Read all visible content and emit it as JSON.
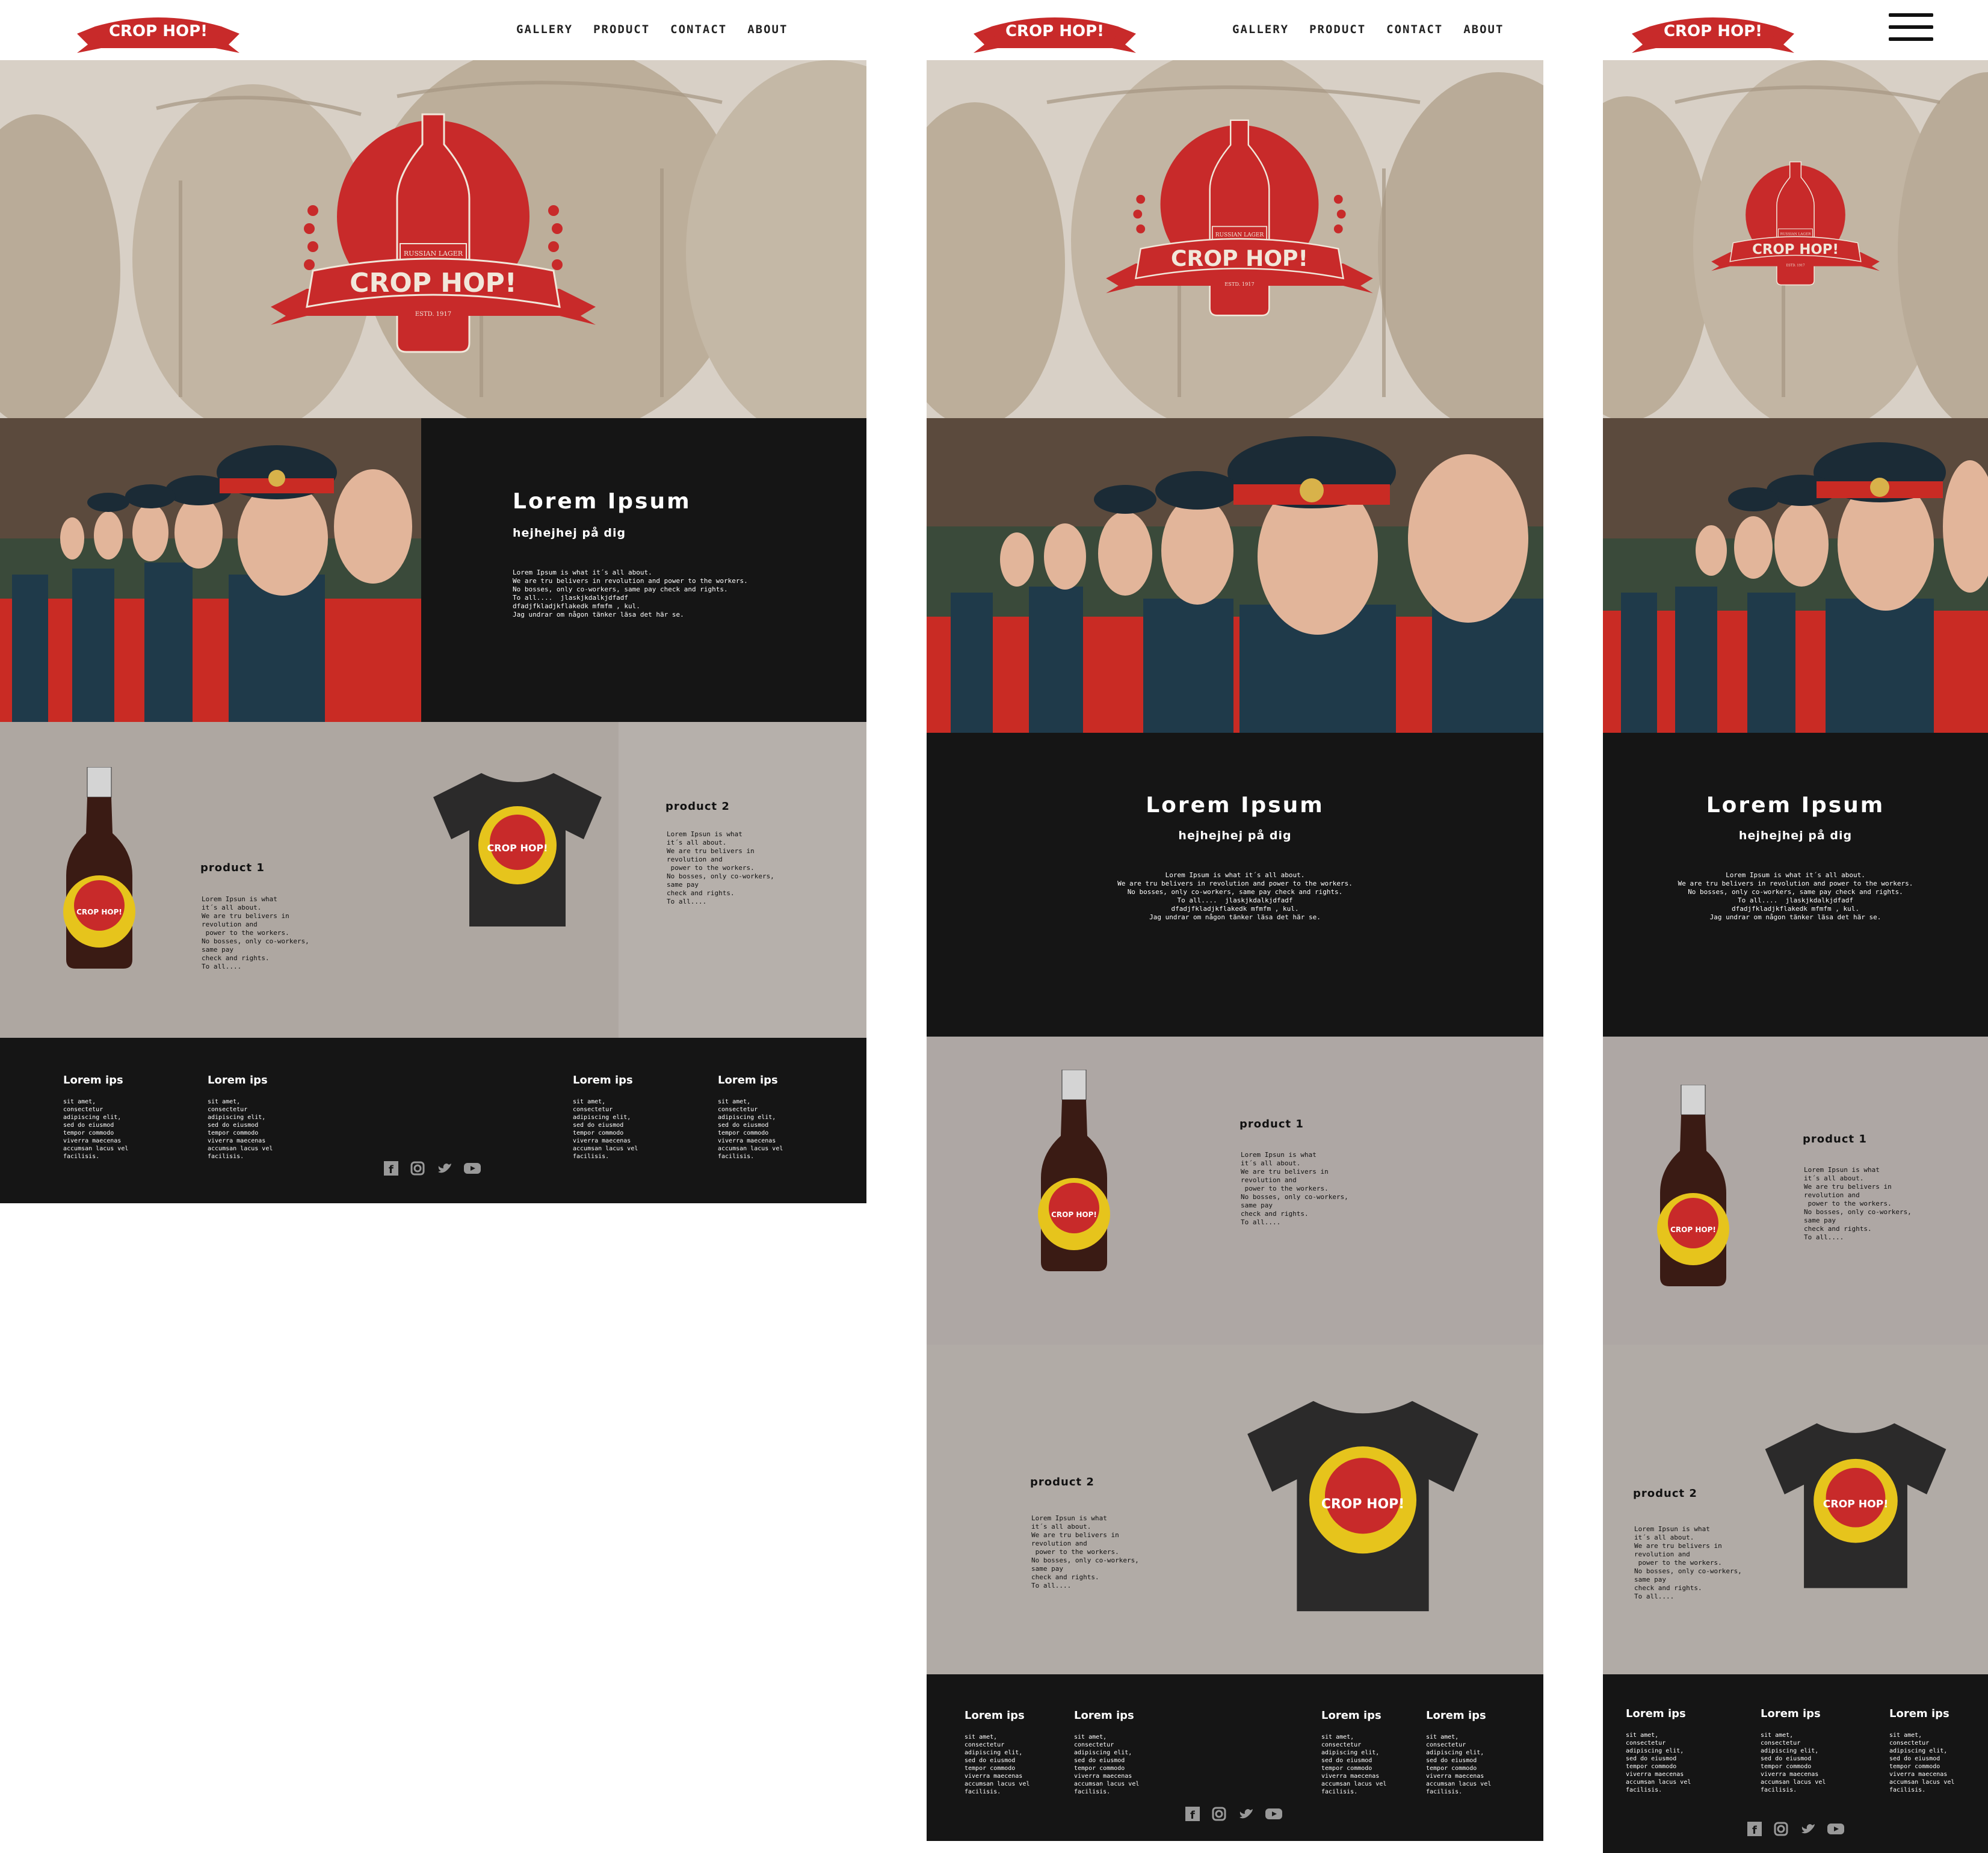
{
  "brand": {
    "name": "CROP HOP!",
    "badge_text": "RUSSIAN LAGER",
    "badge_est": "ESTD. 1917"
  },
  "nav": {
    "gallery": "GALLERY",
    "product": "PRODUCT",
    "contact": "CONTACT",
    "about": "ABOUT"
  },
  "about": {
    "title": "Lorem Ipsum",
    "subtitle": "hejhejhej på dig",
    "body": "Lorem Ipsum is what it´s all about.\nWe are tru belivers in revolution and power to the workers.\nNo bosses, only co-workers, same pay check and rights.\nTo all....  jlaskjkdalkjdfadf\ndfadjfkladjkflakedk mfmfm , kul.\nJag undrar om någon tänker läsa det här se."
  },
  "products": [
    {
      "title": "product 1",
      "body": "Lorem Ipsun is what\nit´s all about.\nWe are tru belivers in\nrevolution and\n power to the workers.\nNo bosses, only co-workers,\nsame pay\ncheck and rights.\nTo all...."
    },
    {
      "title": "product 2",
      "body": "Lorem Ipsun is what\nit´s all about.\nWe are tru belivers in\nrevolution and\n power to the workers.\nNo bosses, only co-workers,\nsame pay\ncheck and rights.\nTo all...."
    }
  ],
  "footer": {
    "heading": "Lorem ips",
    "body": "sit amet,\nconsectetur\nadipiscing elit,\nsed do eiusmod\ntempor commodo\nviverra maecenas\naccumsan lacus vel\nfacilisis."
  },
  "social_icons": [
    "facebook-icon",
    "instagram-icon",
    "twitter-icon",
    "youtube-icon"
  ],
  "colors": {
    "brand_red": "#c82a2a",
    "dark_bg": "#151515",
    "gray_bg": "#aea8a3",
    "label_yellow": "#e6c41c"
  }
}
